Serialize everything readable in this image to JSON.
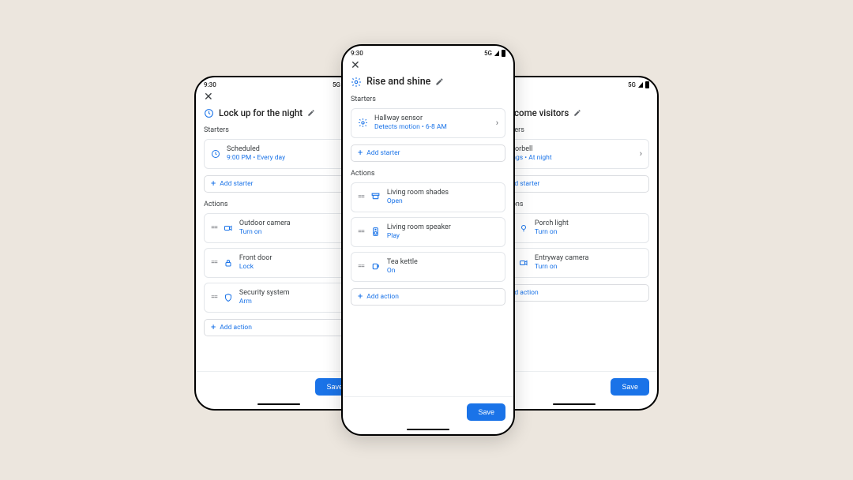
{
  "status": {
    "time": "9:30",
    "network": "5G"
  },
  "labels": {
    "starters": "Starters",
    "actions": "Actions",
    "add_starter": "Add starter",
    "add_action": "Add action",
    "save": "Save"
  },
  "left": {
    "title": "Lock up for the night",
    "starters": [
      {
        "title": "Scheduled",
        "subtitle": "9:00 PM • Every day"
      }
    ],
    "actions": [
      {
        "title": "Outdoor camera",
        "subtitle": "Turn on"
      },
      {
        "title": "Front door",
        "subtitle": "Lock"
      },
      {
        "title": "Security system",
        "subtitle": "Arm"
      }
    ]
  },
  "center": {
    "title": "Rise and shine",
    "starters": [
      {
        "title": "Hallway sensor",
        "subtitle": "Detects motion • 6-8 AM"
      }
    ],
    "actions": [
      {
        "title": "Living room shades",
        "subtitle": "Open"
      },
      {
        "title": "Living room speaker",
        "subtitle": "Play"
      },
      {
        "title": "Tea kettle",
        "subtitle": "On"
      }
    ]
  },
  "right": {
    "title": "Welcome visitors",
    "starters": [
      {
        "title": "Doorbell",
        "subtitle": "Rings • At night"
      }
    ],
    "actions": [
      {
        "title": "Porch light",
        "subtitle": "Turn on"
      },
      {
        "title": "Entryway camera",
        "subtitle": "Turn on"
      }
    ]
  }
}
